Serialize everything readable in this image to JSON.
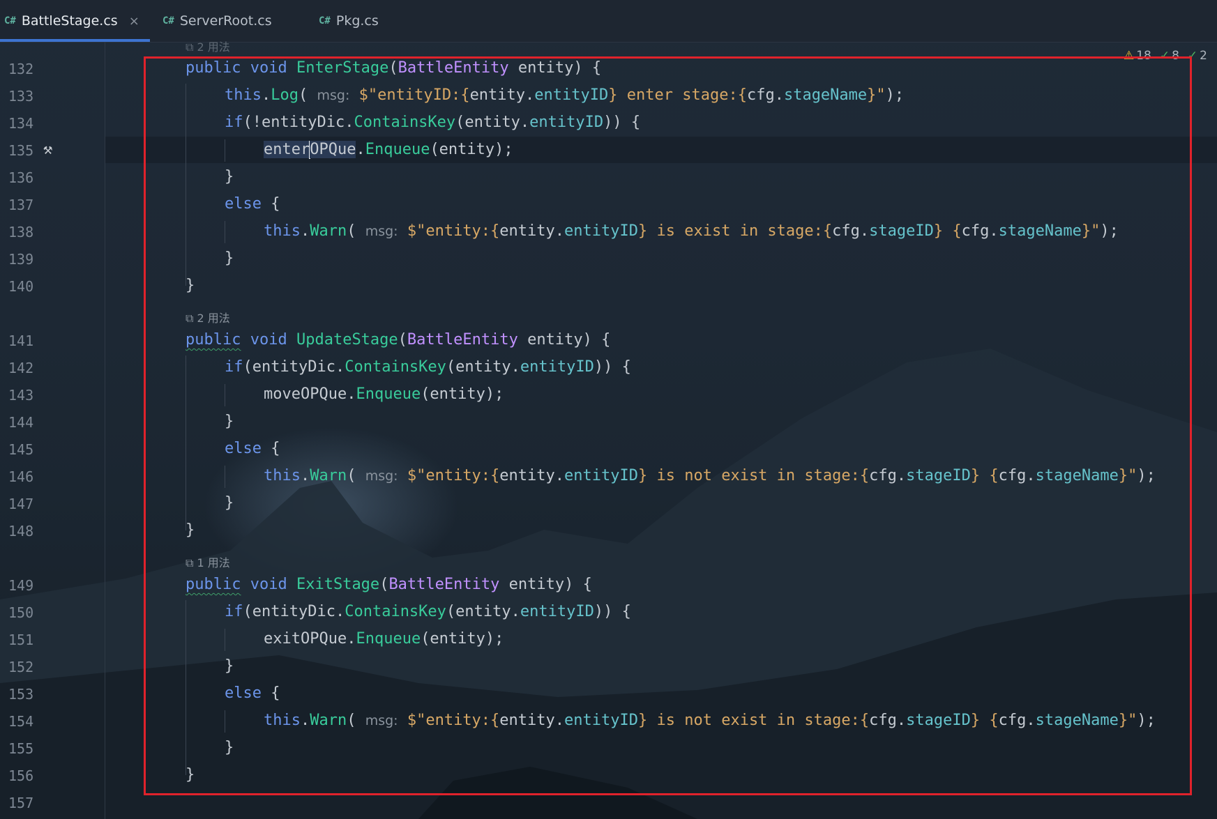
{
  "tabs": [
    {
      "icon": "C#",
      "label": "BattleStage.cs",
      "active": true,
      "close": "×"
    },
    {
      "icon": "C#",
      "label": "ServerRoot.cs",
      "active": false
    },
    {
      "icon": "C#",
      "label": "Pkg.cs",
      "active": false
    }
  ],
  "inspections": {
    "warnings": "18",
    "weak_warnings": "8",
    "suggestions": "2"
  },
  "usages": {
    "top": "2 用法",
    "update": "2 用法",
    "exit": "1 用法"
  },
  "line_numbers": [
    "132",
    "133",
    "134",
    "135",
    "136",
    "137",
    "138",
    "139",
    "140",
    "141",
    "142",
    "143",
    "144",
    "145",
    "146",
    "147",
    "148",
    "149",
    "150",
    "151",
    "152",
    "153",
    "154",
    "155",
    "156",
    "157"
  ],
  "code": {
    "l132": {
      "kw1": "public",
      "kw2": "void",
      "fn": "EnterStage",
      "p1": "(",
      "ty": "BattleEntity",
      "p2": " entity) {"
    },
    "l133": {
      "th": "this",
      "dot": ".",
      "fn": "Log",
      "p1": "(",
      "hint": "msg:",
      "s1": "$\"entityID:{",
      "a": "entity",
      "d1": ".",
      "b": "entityID",
      "s2": "} enter stage:{",
      "c": "cfg",
      "d2": ".",
      "e": "stageName",
      "s3": "}\"",
      "p2": ");"
    },
    "l134": {
      "kw": "if",
      "p1": "(!",
      "a": "entityDic",
      "d": ".",
      "fn": "ContainsKey",
      "p2": "(entity.",
      "b": "entityID",
      "p3": ")) {"
    },
    "l135": {
      "a1": "enter",
      "a2": "OPQue",
      "d": ".",
      "fn": "Enqueue",
      "p": "(entity);"
    },
    "l136": {
      "t": "}"
    },
    "l137": {
      "kw": "else",
      "p": " {"
    },
    "l138": {
      "th": "this",
      "dot": ".",
      "fn": "Warn",
      "p1": "(",
      "hint": "msg:",
      "s1": "$\"entity:{",
      "a": "entity",
      "d1": ".",
      "b": "entityID",
      "s2": "} is exist in stage:{",
      "c": "cfg",
      "d2": ".",
      "e": "stageID",
      "s3": "} {",
      "f": "cfg",
      "d3": ".",
      "g": "stageName",
      "s4": "}\"",
      "p2": ");"
    },
    "l139": {
      "t": "}"
    },
    "l140": {
      "t": "}"
    },
    "l141": {
      "kw1": "public",
      "kw2": "void",
      "fn": "UpdateStage",
      "p1": "(",
      "ty": "BattleEntity",
      "p2": " entity) {"
    },
    "l142": {
      "kw": "if",
      "p1": "(",
      "a": "entityDic",
      "d": ".",
      "fn": "ContainsKey",
      "p2": "(entity.",
      "b": "entityID",
      "p3": ")) {"
    },
    "l143": {
      "a": "moveOPQue",
      "d": ".",
      "fn": "Enqueue",
      "p": "(entity);"
    },
    "l144": {
      "t": "}"
    },
    "l145": {
      "kw": "else",
      "p": " {"
    },
    "l146": {
      "th": "this",
      "dot": ".",
      "fn": "Warn",
      "p1": "(",
      "hint": "msg:",
      "s1": "$\"entity:{",
      "a": "entity",
      "d1": ".",
      "b": "entityID",
      "s2": "} is not exist in stage:{",
      "c": "cfg",
      "d2": ".",
      "e": "stageID",
      "s3": "} {",
      "f": "cfg",
      "d3": ".",
      "g": "stageName",
      "s4": "}\"",
      "p2": ");"
    },
    "l147": {
      "t": "}"
    },
    "l148": {
      "t": "}"
    },
    "l149": {
      "kw1": "public",
      "kw2": "void",
      "fn": "ExitStage",
      "p1": "(",
      "ty": "BattleEntity",
      "p2": " entity) {"
    },
    "l150": {
      "kw": "if",
      "p1": "(",
      "a": "entityDic",
      "d": ".",
      "fn": "ContainsKey",
      "p2": "(entity.",
      "b": "entityID",
      "p3": ")) {"
    },
    "l151": {
      "a": "exitOPQue",
      "d": ".",
      "fn": "Enqueue",
      "p": "(entity);"
    },
    "l152": {
      "t": "}"
    },
    "l153": {
      "kw": "else",
      "p": " {"
    },
    "l154": {
      "th": "this",
      "dot": ".",
      "fn": "Warn",
      "p1": "(",
      "hint": "msg:",
      "s1": "$\"entity:{",
      "a": "entity",
      "d1": ".",
      "b": "entityID",
      "s2": "} is not exist in stage:{",
      "c": "cfg",
      "d2": ".",
      "e": "stageID",
      "s3": "} {",
      "f": "cfg",
      "d3": ".",
      "g": "stageName",
      "s4": "}\"",
      "p2": ");"
    },
    "l155": {
      "t": "}"
    },
    "l156": {
      "t": "}"
    }
  },
  "colors": {
    "keyword": "#6c95eb",
    "method": "#39cc9b",
    "type": "#c191ff",
    "string": "#d8a865",
    "identifier": "#66c3cc",
    "highlight_box": "#e0222b",
    "tab_accent": "#3d74d1"
  },
  "icons": {
    "hammer": "hammer-icon",
    "warning": "warning-icon",
    "check": "check-icon",
    "double_check": "double-check-icon",
    "usage": "usage-link-icon"
  }
}
